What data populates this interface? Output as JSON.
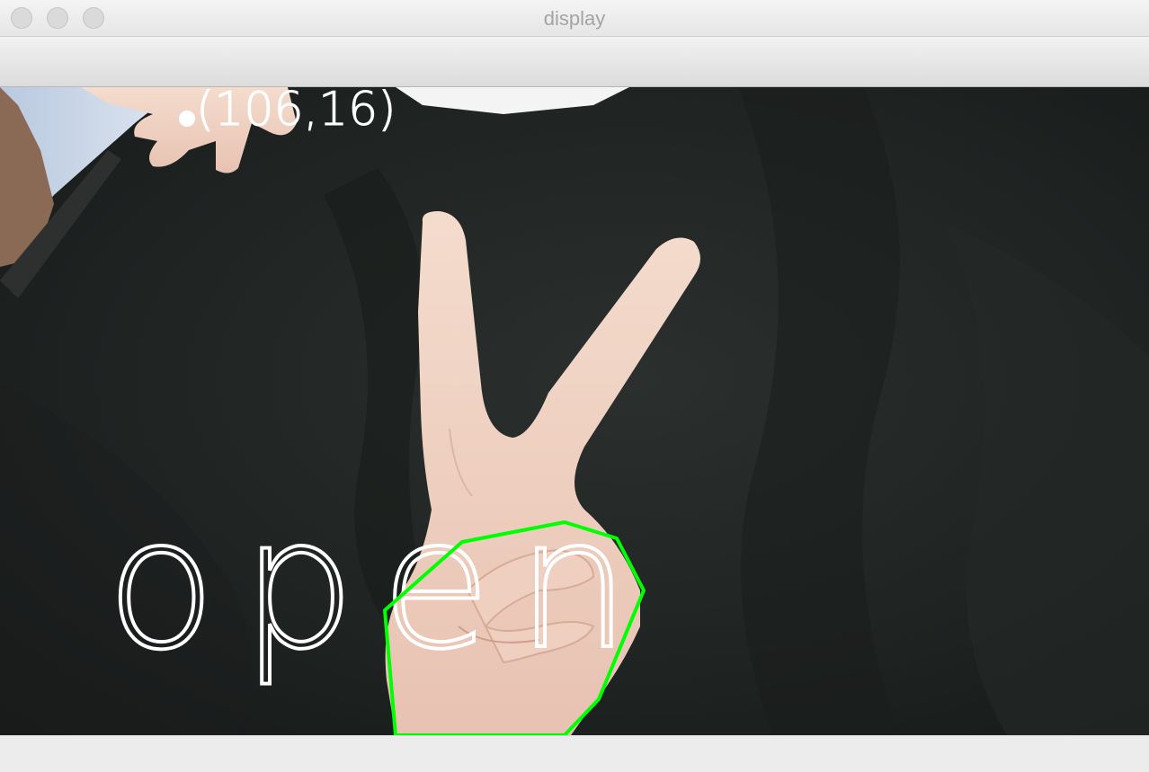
{
  "window": {
    "title": "display"
  },
  "overlay": {
    "coordinate_text": "(106,16)",
    "gesture_label": "open",
    "contour_color": "#00ff00",
    "text_color": "#ffffff"
  }
}
